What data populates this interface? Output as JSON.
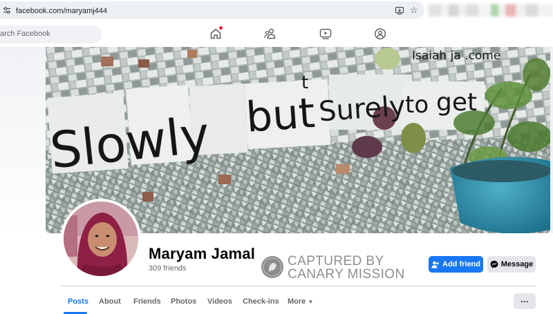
{
  "browser": {
    "url": "facebook.com/maryamj444"
  },
  "nav": {
    "search_placeholder": "Search Facebook",
    "search_visible_text": "arch Facebook"
  },
  "cover": {
    "mosaic_text": {
      "main_word_1": "Slowly",
      "main_word_2": "but",
      "main_word_3": "t",
      "main_word_4": "Surely",
      "main_word_5": "to",
      "main_word_6": "get",
      "top_text": "Isaiah ja .come"
    }
  },
  "profile": {
    "name": "Maryam Jamal",
    "friends": "309 friends"
  },
  "watermark": {
    "line1": "CAPTURED BY",
    "line2": "CANARY MISSION"
  },
  "actions": {
    "add_friend": "Add friend",
    "message": "Message",
    "more": "···"
  },
  "tabs": [
    {
      "label": "Posts"
    },
    {
      "label": "About"
    },
    {
      "label": "Friends"
    },
    {
      "label": "Photos"
    },
    {
      "label": "Videos"
    },
    {
      "label": "Check-ins"
    },
    {
      "label": "More"
    }
  ],
  "colors": {
    "fb_blue": "#1877f2",
    "button_gray": "#e4e6eb",
    "text_secondary": "#65676b",
    "notification_red": "#e41e3f",
    "watermark_gray": "#8e8e8e"
  }
}
